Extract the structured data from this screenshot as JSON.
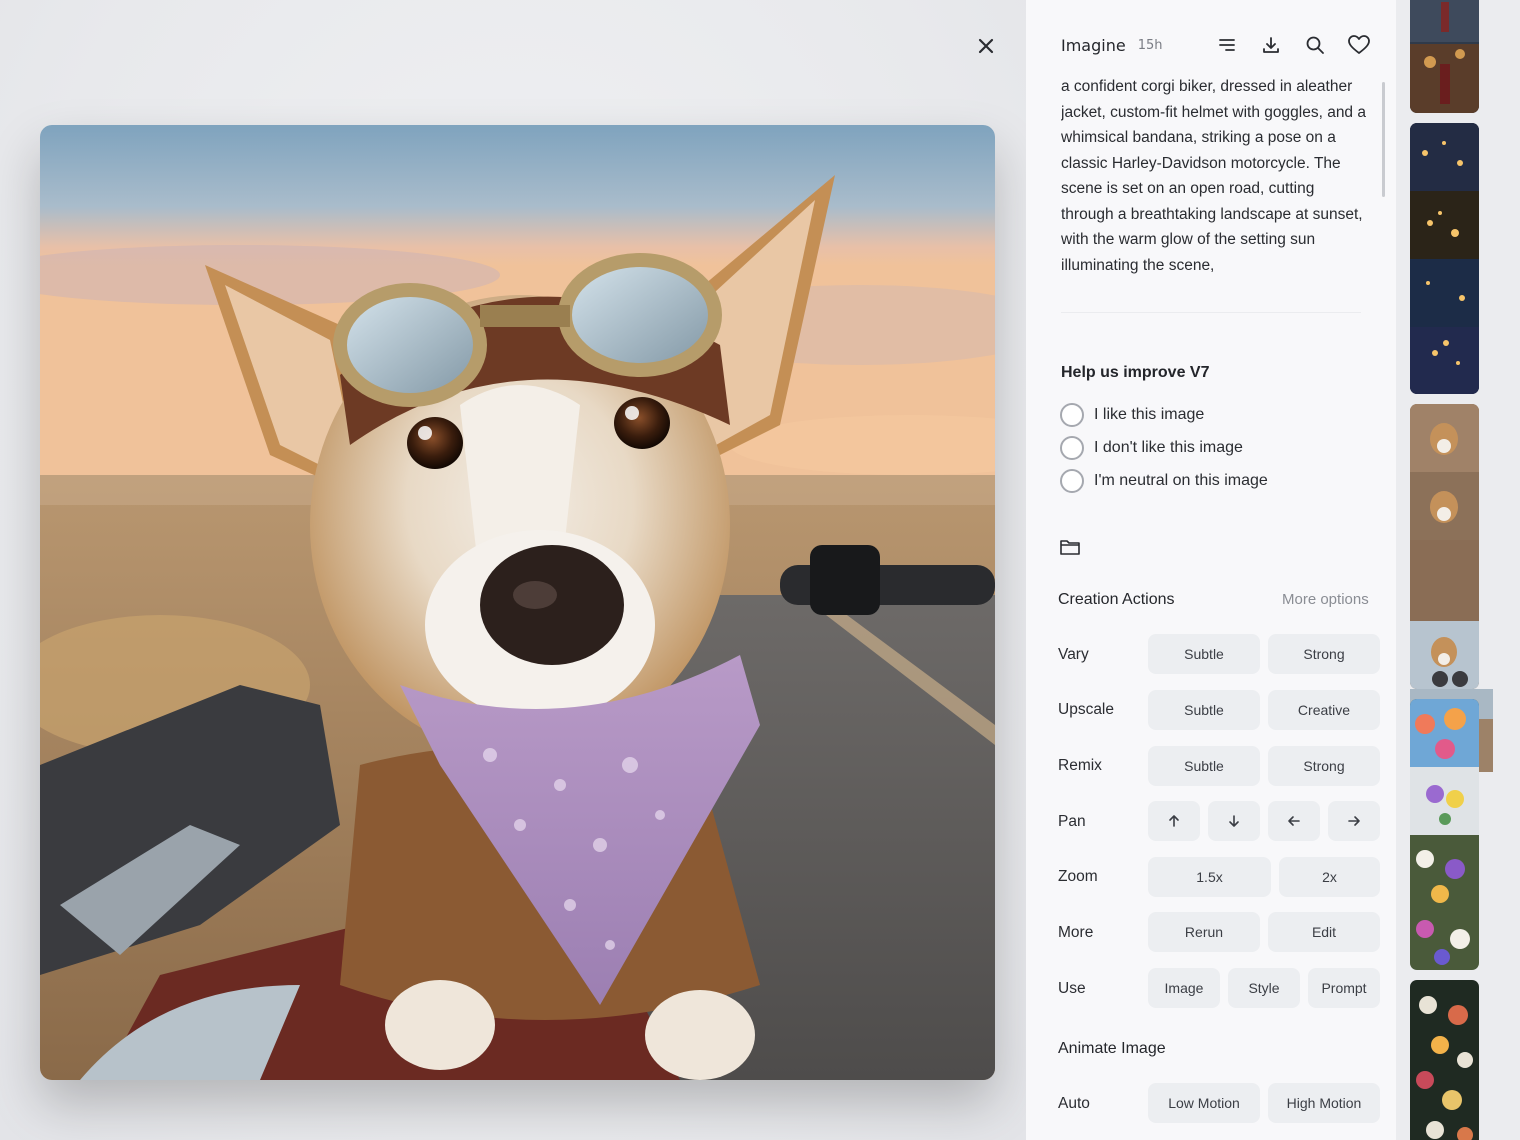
{
  "viewer": {
    "close_icon": "close-icon",
    "image_subject": "corgi-biker-photo"
  },
  "header": {
    "app_name": "Imagine",
    "age": "15h",
    "icons": [
      "list-icon",
      "download-icon",
      "search-icon",
      "heart-icon"
    ]
  },
  "prompt": {
    "text": "a confident corgi biker, dressed in aleather jacket, custom-fit helmet with goggles, and a whimsical bandana, striking a pose on a classic Harley-Davidson motorcycle. The scene is set on an open road, cutting through a breathtaking landscape at sunset, with the warm glow of the setting sun illuminating the scene,"
  },
  "feedback": {
    "title": "Help us improve V7",
    "options": [
      "I like this image",
      "I don't like this image",
      "I'm neutral on this image"
    ]
  },
  "actions": {
    "title": "Creation Actions",
    "more_options": "More options",
    "vary": {
      "label": "Vary",
      "buttons": [
        "Subtle",
        "Strong"
      ]
    },
    "upscale": {
      "label": "Upscale",
      "buttons": [
        "Subtle",
        "Creative"
      ]
    },
    "remix": {
      "label": "Remix",
      "buttons": [
        "Subtle",
        "Strong"
      ]
    },
    "pan": {
      "label": "Pan",
      "buttons": [
        "arrow-up-icon",
        "arrow-down-icon",
        "arrow-left-icon",
        "arrow-right-icon"
      ]
    },
    "zoom": {
      "label": "Zoom",
      "buttons": [
        "1.5x",
        "2x"
      ]
    },
    "more": {
      "label": "More",
      "buttons": [
        "Rerun",
        "Edit"
      ]
    },
    "use": {
      "label": "Use",
      "buttons": [
        "Image",
        "Style",
        "Prompt"
      ]
    }
  },
  "animate": {
    "title": "Animate Image",
    "auto": {
      "label": "Auto",
      "buttons": [
        "Low Motion",
        "High Motion"
      ]
    }
  },
  "colors": {
    "panel_bg": "#f8f8fa",
    "button_bg": "#eceef1",
    "strip_bg": "#ebecef"
  }
}
